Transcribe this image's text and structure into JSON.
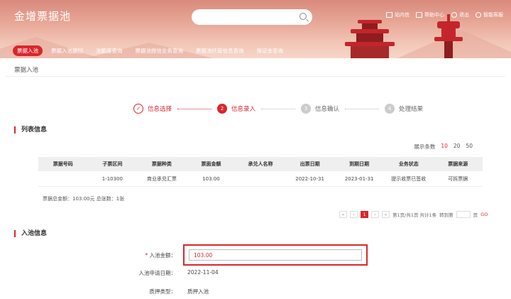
{
  "header": {
    "title": "金增票据池",
    "search": {
      "placeholder": ""
    },
    "utils": [
      "站内信",
      "帮助中心",
      "退出",
      "智能客服"
    ]
  },
  "nav": {
    "items": [
      {
        "label": "票据入池",
        "active": true
      },
      {
        "label": "票据入池撤回",
        "active": false
      },
      {
        "label": "池额度查询",
        "active": false
      },
      {
        "label": "票据池授信业务查询",
        "active": false
      },
      {
        "label": "票据池托管信息查询",
        "active": false
      },
      {
        "label": "保证金查询",
        "active": false
      }
    ]
  },
  "breadcrumb": "票据入池",
  "steps": [
    {
      "num": "✓",
      "label": "信息选择",
      "state": "done"
    },
    {
      "num": "2",
      "label": "信息录入",
      "state": "active"
    },
    {
      "num": "3",
      "label": "信息确认",
      "state": "todo"
    },
    {
      "num": "4",
      "label": "处理结果",
      "state": "todo"
    }
  ],
  "list_section": {
    "title": "列表信息",
    "page_size_label": "展示条数",
    "page_sizes": [
      "10",
      "20",
      "50"
    ],
    "page_size_selected": "10"
  },
  "table": {
    "headers": [
      "票据号码",
      "子票区间",
      "票据种类",
      "票面金额",
      "承兑人名称",
      "出票日期",
      "到期日期",
      "业务状态",
      "票据来源"
    ],
    "rows": [
      [
        "",
        "1-10300",
        "商业承兑汇票",
        "103.00",
        "",
        "2022-10-31",
        "2023-01-31",
        "提示收票已签收",
        "可拆票据"
      ]
    ],
    "summary": "票据总金额：103.00元 总张数：1张"
  },
  "pager": {
    "prev": "‹",
    "current": "1",
    "next": "›",
    "info": "第1页/共1页 共计1条",
    "jump_label": "转到第",
    "page_unit": "页",
    "go": "GO"
  },
  "pool_section": {
    "title": "入池信息",
    "amount_label": "入池金额：",
    "amount_value": "103.00",
    "apply_date_label": "入池申请日期：",
    "apply_date_value": "2022-11-04",
    "pledge_label": "质押类型：",
    "pledge_value": "质押入池"
  },
  "colors": {
    "accent": "#d9262b",
    "header_bg": "#e8a898"
  }
}
